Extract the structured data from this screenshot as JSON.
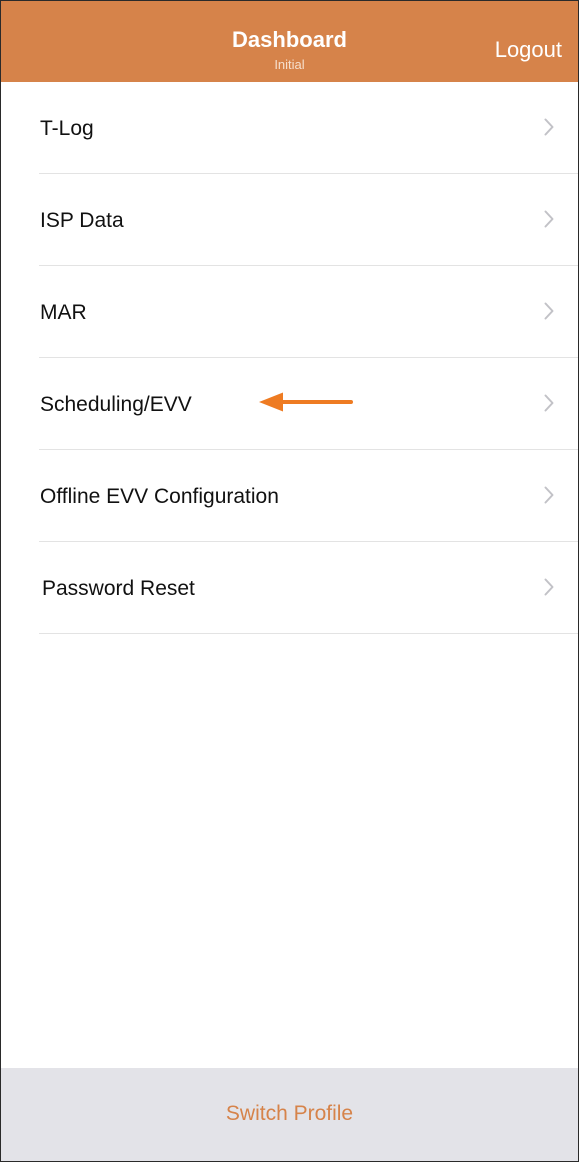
{
  "header": {
    "title": "Dashboard",
    "subtitle": "Initial",
    "logout_label": "Logout"
  },
  "menu": {
    "items": [
      {
        "label": "T-Log"
      },
      {
        "label": "ISP Data"
      },
      {
        "label": "MAR"
      },
      {
        "label": "Scheduling/EVV"
      },
      {
        "label": "Offline EVV Configuration"
      },
      {
        "label": "Password Reset"
      }
    ]
  },
  "footer": {
    "switch_profile_label": "Switch Profile"
  },
  "colors": {
    "header_bg": "#d6834a",
    "accent": "#d6834a",
    "annotation_arrow": "#ee7b22",
    "footer_bg": "#e3e3e8",
    "chevron": "#c2c2c7"
  },
  "icons": {
    "chevron": "chevron-right-icon",
    "annotation": "arrow-left-icon"
  }
}
